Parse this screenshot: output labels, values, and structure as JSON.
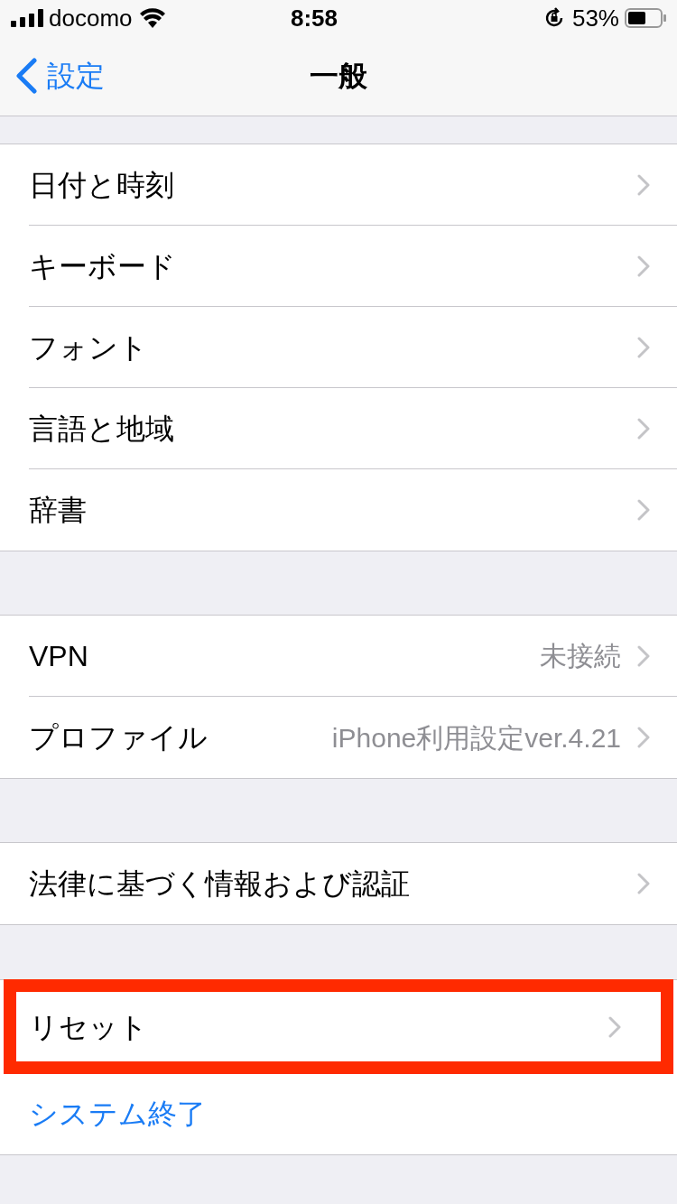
{
  "status_bar": {
    "carrier": "docomo",
    "time": "8:58",
    "battery": "53%"
  },
  "nav": {
    "back": "設定",
    "title": "一般"
  },
  "groups": [
    {
      "rows": [
        {
          "label": "日付と時刻",
          "kind": "nav",
          "highlighted": false
        },
        {
          "label": "キーボード",
          "kind": "nav",
          "highlighted": false
        },
        {
          "label": "フォント",
          "kind": "nav",
          "highlighted": false
        },
        {
          "label": "言語と地域",
          "kind": "nav",
          "highlighted": false
        },
        {
          "label": "辞書",
          "kind": "nav",
          "highlighted": false
        }
      ]
    },
    {
      "rows": [
        {
          "label": "VPN",
          "kind": "nav",
          "value": "未接続",
          "highlighted": false
        },
        {
          "label": "プロファイル",
          "kind": "nav",
          "value": "iPhone利用設定ver.4.21",
          "highlighted": false
        }
      ]
    },
    {
      "rows": [
        {
          "label": "法律に基づく情報および認証",
          "kind": "nav",
          "highlighted": false
        }
      ]
    },
    {
      "rows": [
        {
          "label": "リセット",
          "kind": "nav",
          "highlighted": true
        },
        {
          "label": "システム終了",
          "kind": "action",
          "highlighted": false
        }
      ]
    }
  ]
}
